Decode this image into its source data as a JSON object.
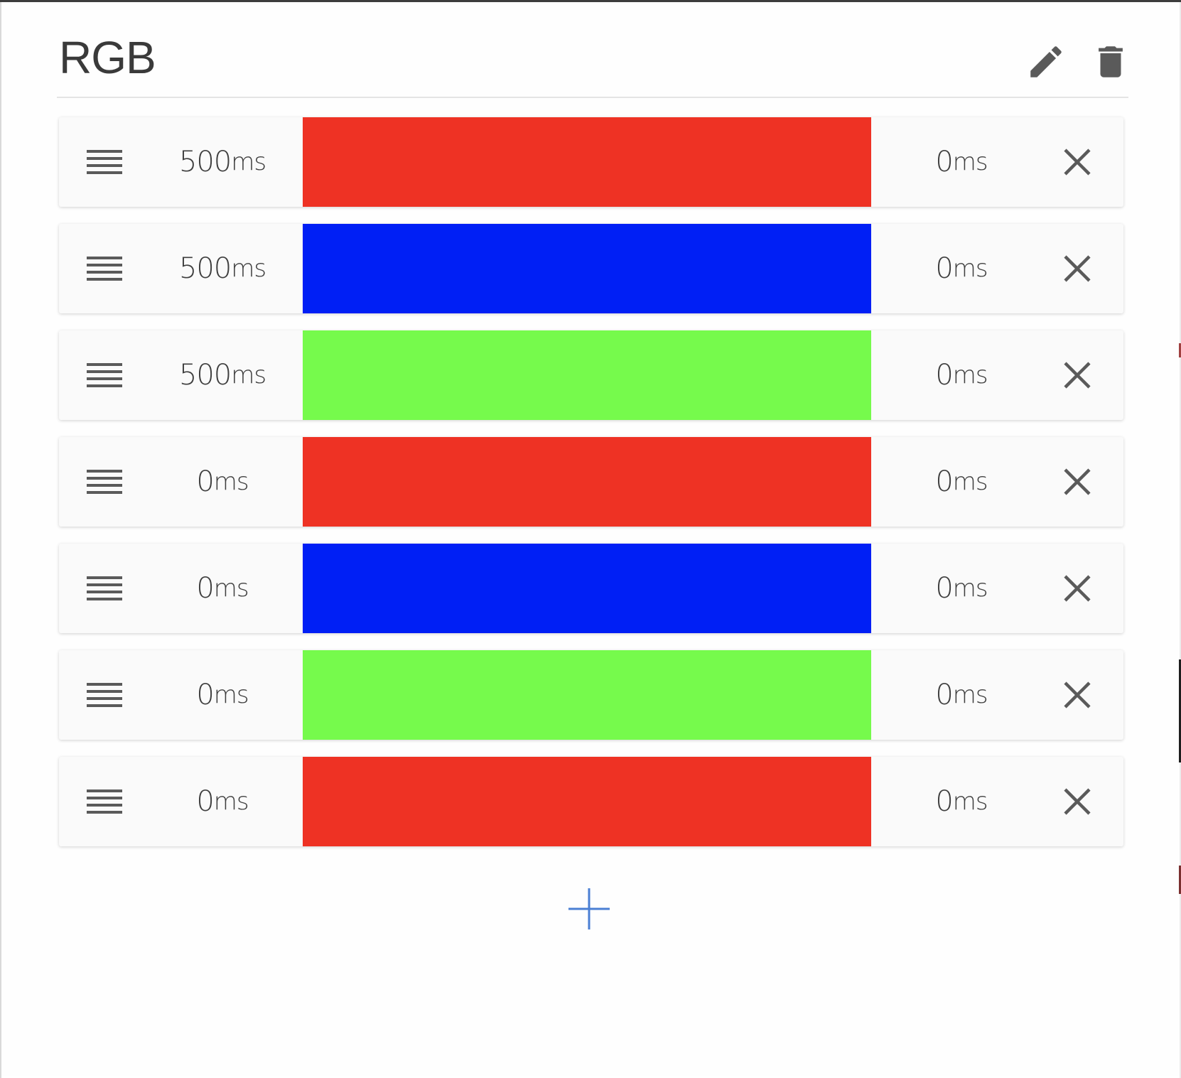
{
  "header": {
    "title": "RGB",
    "edit_icon": "pencil-icon",
    "delete_icon": "trash-icon"
  },
  "unit_label": "ms",
  "steps": [
    {
      "fade_in": "500",
      "color": "#ee3224",
      "hold": "0"
    },
    {
      "fade_in": "500",
      "color": "#001ff5",
      "hold": "0"
    },
    {
      "fade_in": "500",
      "color": "#76fa4c",
      "hold": "0"
    },
    {
      "fade_in": "0",
      "color": "#ee3224",
      "hold": "0"
    },
    {
      "fade_in": "0",
      "color": "#001ff5",
      "hold": "0"
    },
    {
      "fade_in": "0",
      "color": "#76fa4c",
      "hold": "0"
    },
    {
      "fade_in": "0",
      "color": "#ee3224",
      "hold": "0"
    }
  ],
  "icons": {
    "drag": "drag-handle-icon",
    "remove": "close-icon",
    "add": "plus-icon"
  },
  "colors": {
    "accent": "#4a7fd4",
    "icon": "#5a5a5a",
    "text": "#3e3e3e"
  }
}
